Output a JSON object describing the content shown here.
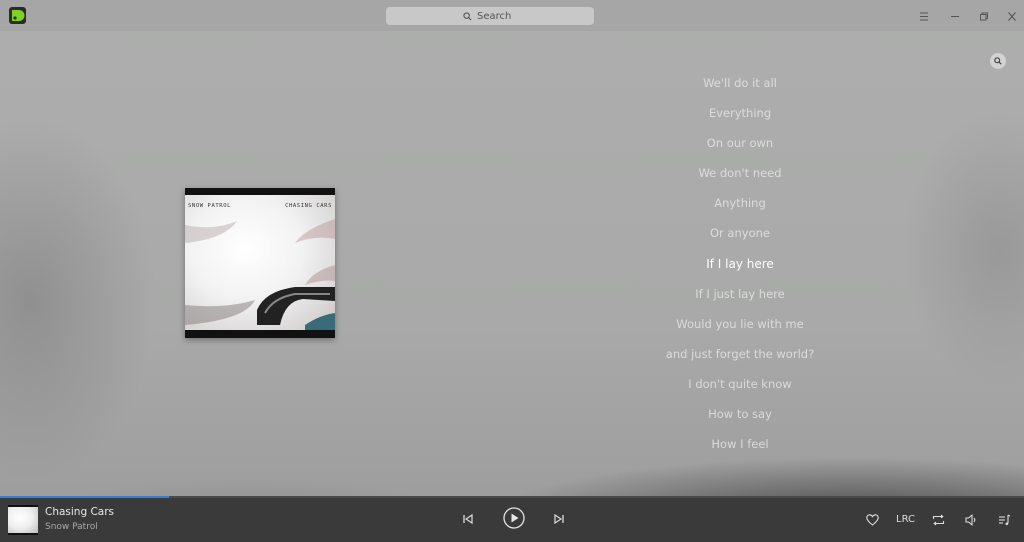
{
  "titlebar": {
    "search_placeholder": "Search"
  },
  "album": {
    "cover_artist": "SNOW PATROL",
    "cover_title": "CHASING CARS"
  },
  "lyrics": [
    {
      "text": "We'll do it all",
      "active": false
    },
    {
      "text": "Everything",
      "active": false
    },
    {
      "text": "On our own",
      "active": false
    },
    {
      "text": "We don't need",
      "active": false
    },
    {
      "text": "Anything",
      "active": false
    },
    {
      "text": "Or anyone",
      "active": false
    },
    {
      "text": "If I lay here",
      "active": true
    },
    {
      "text": "If I just lay here",
      "active": false
    },
    {
      "text": "Would you lie with me",
      "active": false
    },
    {
      "text": "and just forget the world?",
      "active": false
    },
    {
      "text": "I don't quite know",
      "active": false
    },
    {
      "text": "How to say",
      "active": false
    },
    {
      "text": "How I feel",
      "active": false
    }
  ],
  "player": {
    "track_title": "Chasing Cars",
    "track_artist": "Snow Patrol",
    "progress": 0.165,
    "lrc_label": "LRC"
  },
  "colors": {
    "accent": "#3b7fd1",
    "player_bg": "#3a3a3a"
  }
}
